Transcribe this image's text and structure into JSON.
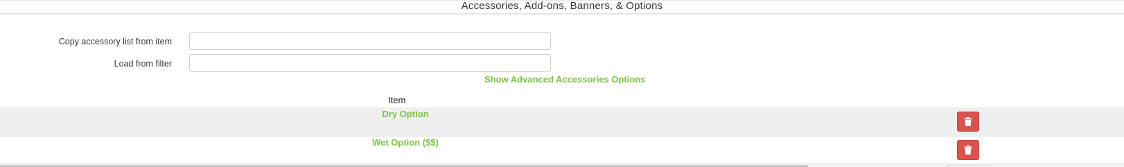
{
  "section": {
    "title": "Accessories, Add-ons, Banners, & Options"
  },
  "form": {
    "copy_label": "Copy accessory list from item",
    "copy_value": "",
    "load_label": "Load from filter",
    "load_value": ""
  },
  "advanced_link": "Show Advanced Accessories Options",
  "table": {
    "columns": [
      "Item"
    ],
    "rows": [
      {
        "item": "Dry Option",
        "delete_icon": "trash-icon"
      },
      {
        "item": "Wet Option ($$)",
        "delete_icon": "trash-icon"
      }
    ]
  },
  "colors": {
    "link": "#7cc242",
    "danger": "#d9534f",
    "row_shade": "#efefef"
  }
}
